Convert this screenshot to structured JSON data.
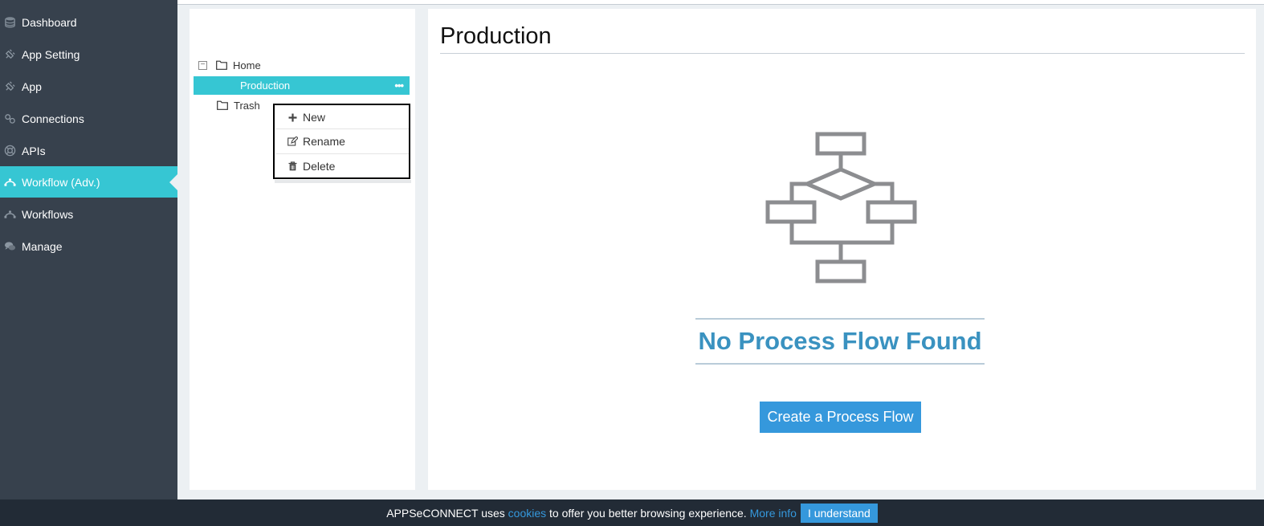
{
  "sidebar": {
    "items": [
      {
        "label": "Dashboard",
        "icon": "database-icon"
      },
      {
        "label": "App Setting",
        "icon": "plug-icon"
      },
      {
        "label": "App",
        "icon": "plug-icon"
      },
      {
        "label": "Connections",
        "icon": "link-icon"
      },
      {
        "label": "APIs",
        "icon": "lifebuoy-icon"
      },
      {
        "label": "Workflow (Adv.)",
        "icon": "workflow-icon",
        "active": true
      },
      {
        "label": "Workflows",
        "icon": "workflow-icon"
      },
      {
        "label": "Manage",
        "icon": "chat-icon"
      }
    ]
  },
  "tree": {
    "home": "Home",
    "production": "Production",
    "trash": "Trash"
  },
  "context_menu": {
    "new": "New",
    "rename": "Rename",
    "delete": "Delete"
  },
  "main": {
    "title": "Production",
    "empty_message": "No Process Flow Found",
    "create_button": "Create a Process Flow"
  },
  "cookie": {
    "text_before": "APPSeCONNECT uses",
    "cookies_link": "cookies",
    "text_after": "to offer you better browsing experience.",
    "more_info": "More info",
    "accept": "I understand"
  },
  "colors": {
    "sidebar_bg": "#37414d",
    "accent": "#36c6d3",
    "primary_button": "#3598dc",
    "empty_title": "#3a92c0"
  }
}
